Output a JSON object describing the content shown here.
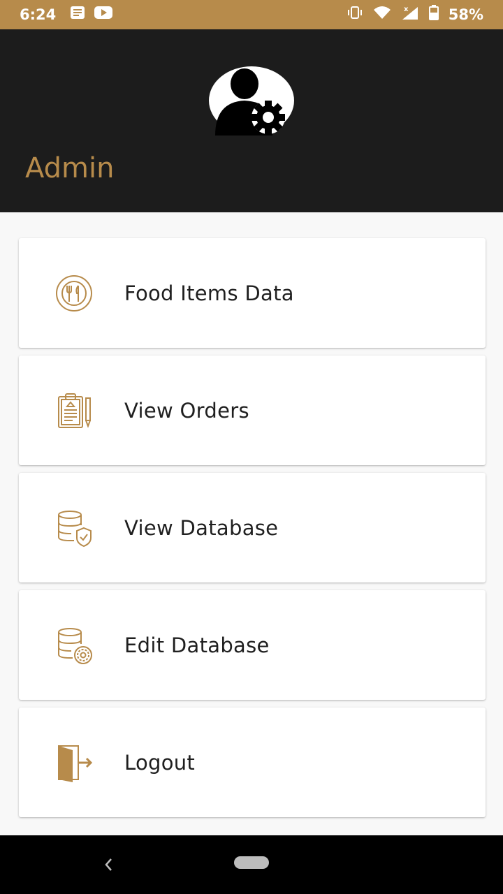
{
  "status_bar": {
    "time": "6:24",
    "battery_percent": "58%",
    "left_icons": [
      "notes-icon",
      "youtube-icon"
    ],
    "right_icons": [
      "vibrate-icon",
      "wifi-icon",
      "signal-icon",
      "battery-icon"
    ]
  },
  "header": {
    "title": "Admin",
    "avatar_icon": "admin-settings-avatar-icon"
  },
  "menu": {
    "items": [
      {
        "label": "Food Items Data",
        "icon": "fork-spoon-plate-icon"
      },
      {
        "label": "View Orders",
        "icon": "clipboard-pen-icon"
      },
      {
        "label": "View Database",
        "icon": "database-shield-icon"
      },
      {
        "label": "Edit Database",
        "icon": "database-gear-icon"
      },
      {
        "label": "Logout",
        "icon": "logout-door-icon"
      }
    ]
  },
  "colors": {
    "accent": "#b78b4b",
    "header_bg": "#1c1c1c",
    "page_bg": "#f8f8f8",
    "card_bg": "#ffffff",
    "text": "#1f1f1f"
  }
}
